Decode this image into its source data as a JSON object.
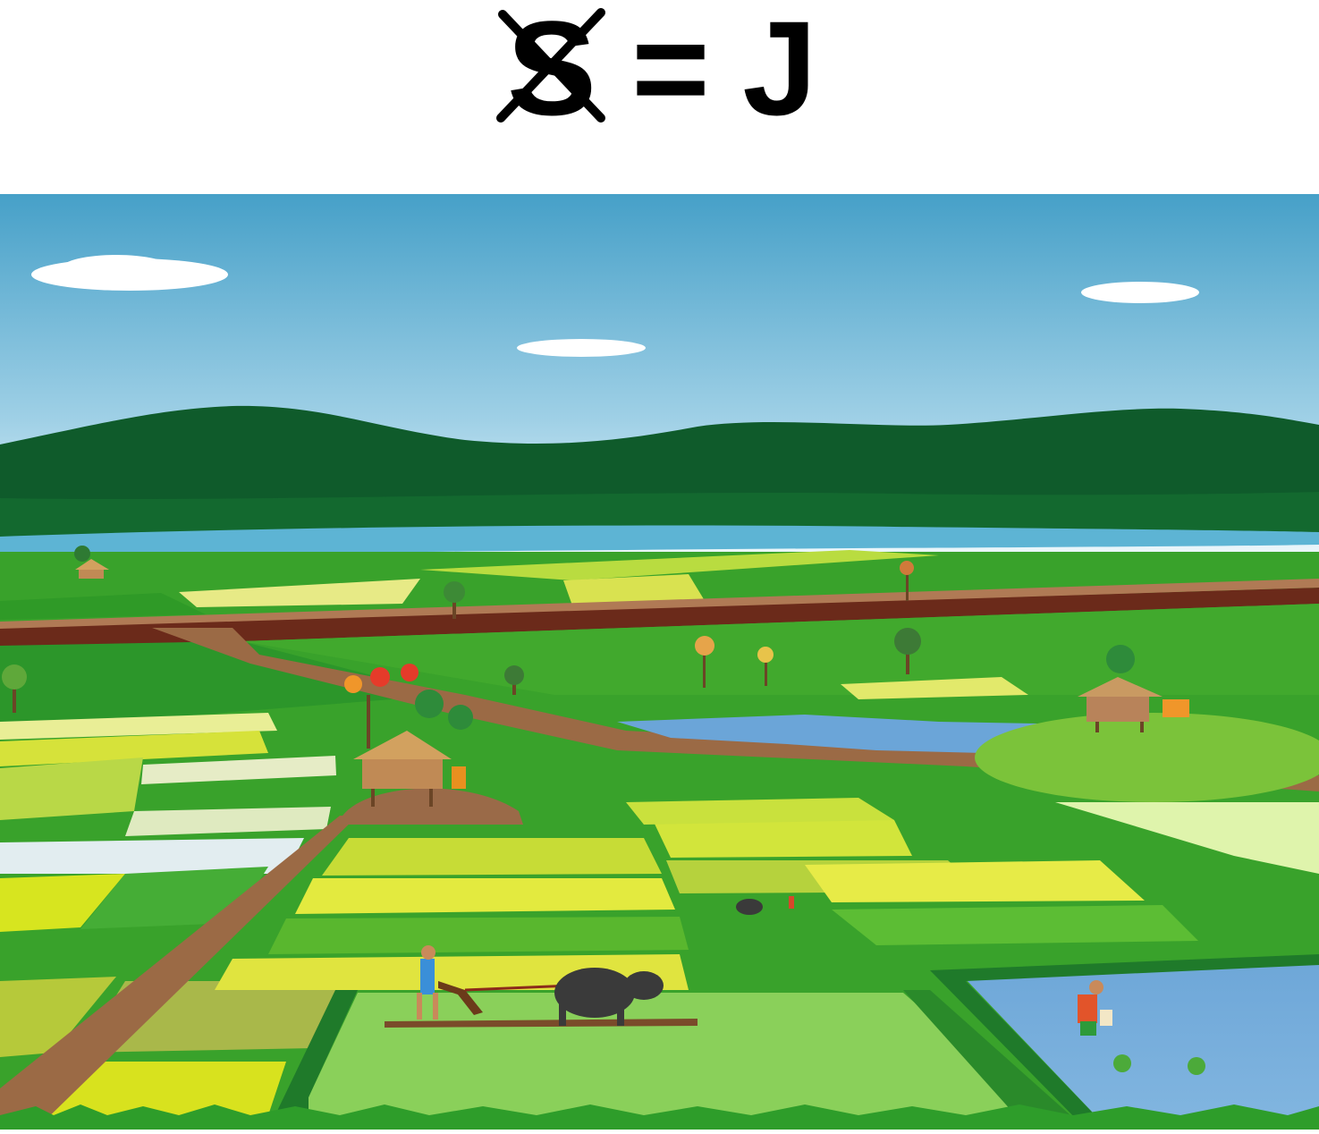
{
  "puzzle": {
    "crossed_letter": "S",
    "equals": "=",
    "result_letter": "J",
    "cross_color": "#000000"
  },
  "scene": {
    "subject": "rice-field-landscape",
    "palette": {
      "sky_top": "#4aa3c9",
      "sky_bottom": "#ffffff",
      "hills": "#0e5a2a",
      "river": "#5fb6d6",
      "field_green": "#3aa52b",
      "field_yellow": "#d8df2a",
      "path": "#9b6a45",
      "pond": "#72a8d6"
    }
  }
}
